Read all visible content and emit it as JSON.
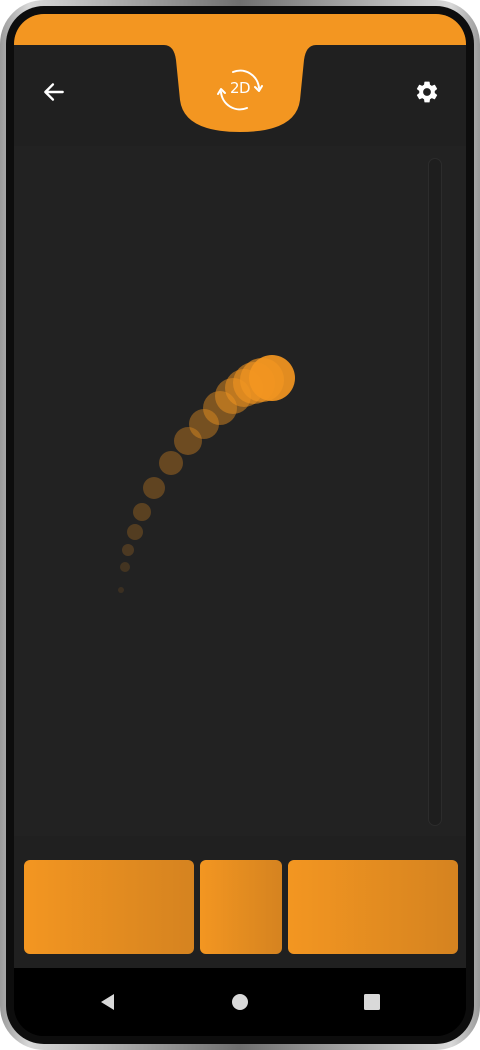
{
  "app": {
    "accent_color": "#f39621",
    "background_color": "#222222",
    "bar_color": "#202020"
  },
  "header": {
    "back_icon": "arrow-left-icon",
    "mode_label": "2D",
    "mode_icon": "rotate-icon",
    "settings_icon": "gear-icon"
  },
  "canvas": {
    "trail_icon": "motion-trail-dots"
  },
  "controls": {
    "buttons": [
      "left-action",
      "center-action",
      "right-action"
    ]
  },
  "navbar": {
    "back_icon": "triangle-back-icon",
    "home_icon": "circle-home-icon",
    "recents_icon": "square-recents-icon"
  }
}
